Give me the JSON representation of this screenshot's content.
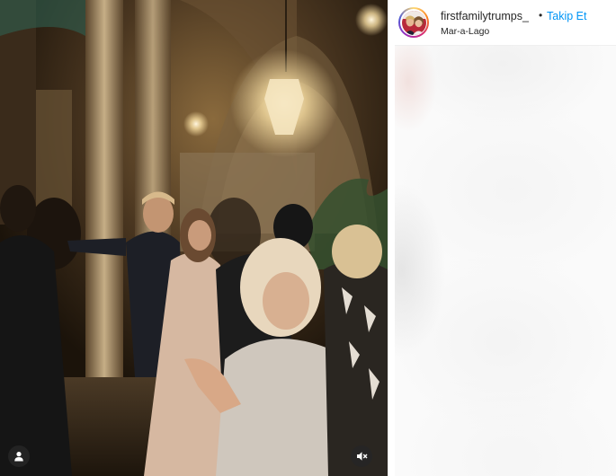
{
  "post": {
    "username": "firstfamilytrumps_",
    "separator": "•",
    "follow_label": "Takip Et",
    "location": "Mar-a-Lago"
  },
  "media": {
    "type": "video",
    "tag_icon": "user-tag-icon",
    "mute_icon": "speaker-muted-icon"
  },
  "colors": {
    "follow": "#0095f6",
    "text": "#262626",
    "border": "#efefef"
  }
}
